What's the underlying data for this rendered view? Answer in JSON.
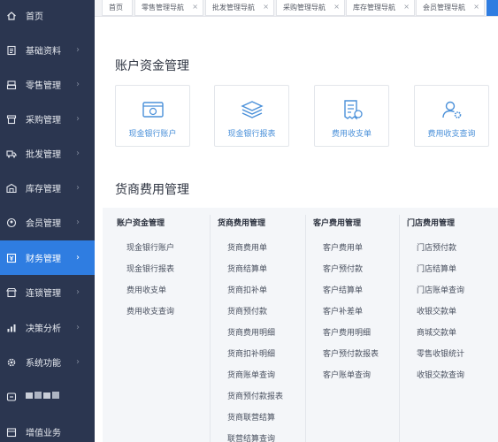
{
  "sidebar": {
    "items": [
      {
        "label": "首页",
        "icon": "home-icon"
      },
      {
        "label": "基础资料",
        "icon": "document-icon"
      },
      {
        "label": "零售管理",
        "icon": "retail-icon"
      },
      {
        "label": "采购管理",
        "icon": "purchase-icon"
      },
      {
        "label": "批发管理",
        "icon": "truck-icon"
      },
      {
        "label": "库存管理",
        "icon": "warehouse-icon"
      },
      {
        "label": "会员管理",
        "icon": "member-icon"
      },
      {
        "label": "财务管理",
        "icon": "finance-icon",
        "active": true
      },
      {
        "label": "连锁管理",
        "icon": "chain-icon"
      },
      {
        "label": "决策分析",
        "icon": "chart-icon"
      },
      {
        "label": "系统功能",
        "icon": "gear-icon"
      },
      {
        "label": "",
        "icon": "logo-icon"
      },
      {
        "label": "增值业务",
        "icon": "value-added-icon"
      }
    ],
    "arrow": "›"
  },
  "tabs": [
    {
      "label": "首页"
    },
    {
      "label": "零售管理导航",
      "close": "×"
    },
    {
      "label": "批发管理导航",
      "close": "×"
    },
    {
      "label": "采购管理导航",
      "close": "×"
    },
    {
      "label": "库存管理导航",
      "close": "×"
    },
    {
      "label": "会员管理导航",
      "close": "×"
    }
  ],
  "main": {
    "section1_title": "账户资金管理",
    "cards": [
      {
        "label": "现金银行账户",
        "icon": "bank-account-icon"
      },
      {
        "label": "现金银行报表",
        "icon": "layers-report-icon"
      },
      {
        "label": "费用收支单",
        "icon": "receipt-icon"
      },
      {
        "label": "费用收支查询",
        "icon": "user-settings-icon"
      }
    ],
    "section2_title": "货商费用管理",
    "columns": [
      {
        "heading": "账户资金管理",
        "links": [
          "现金银行账户",
          "现金银行报表",
          "费用收支单",
          "费用收支查询"
        ]
      },
      {
        "heading": "货商费用管理",
        "links": [
          "货商费用单",
          "货商结算单",
          "货商扣补单",
          "货商预付款",
          "货商费用明细",
          "货商扣补明细",
          "货商账单查询",
          "货商预付款报表",
          "货商联营结算",
          "联营结算查询"
        ]
      },
      {
        "heading": "客户费用管理",
        "links": [
          "客户费用单",
          "客户预付款",
          "客户结算单",
          "客户补差单",
          "客户费用明细",
          "客户预付款报表",
          "客户账单查询"
        ]
      },
      {
        "heading": "门店费用管理",
        "links": [
          "门店预付款",
          "门店结算单",
          "门店账单查询",
          "收银交款单",
          "商城交款单",
          "零售收银统计",
          "收银交款查询"
        ]
      }
    ]
  },
  "colors": {
    "sidebar_bg": "#2b3650",
    "active_blue": "#2f7de1",
    "link_blue": "#4a90d9"
  }
}
